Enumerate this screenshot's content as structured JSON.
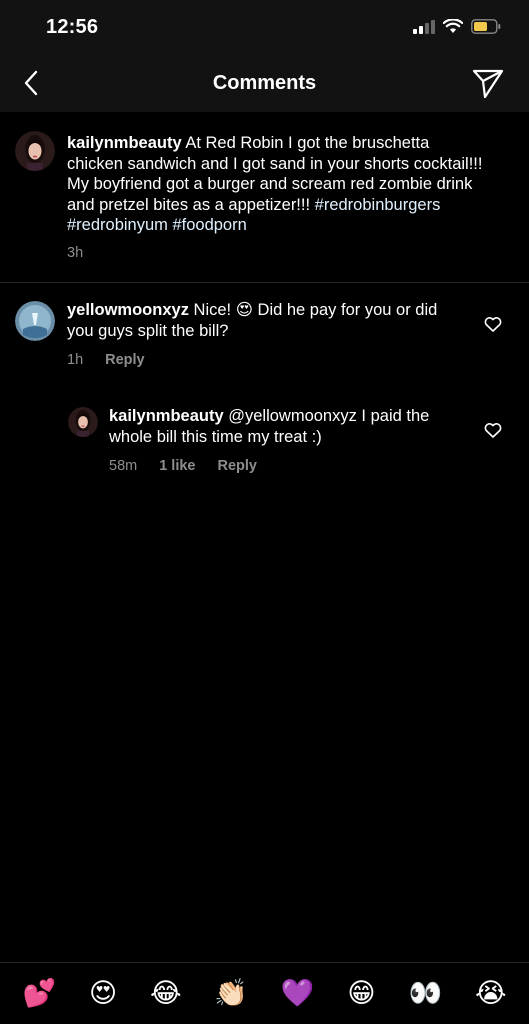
{
  "status": {
    "time": "12:56"
  },
  "header": {
    "title": "Comments"
  },
  "caption": {
    "username": "kailynmbeauty",
    "text": " At Red Robin I got the bruschetta chicken sandwich and I got sand in your shorts cocktail!!! My boyfriend got a burger and scream red zombie drink and pretzel bites as a appetizer!!!",
    "hashtags": "#redrobinburgers #redrobinyum #foodporn",
    "time": "3h"
  },
  "comments": [
    {
      "username": "yellowmoonxyz",
      "text_before": " Nice!",
      "emoji": "😍",
      "text_after": " Did he pay for you or did you guys split the bill?",
      "time": "1h",
      "reply_label": "Reply"
    }
  ],
  "replies": [
    {
      "username": "kailynmbeauty",
      "text": " @yellowmoonxyz I paid the whole bill this time my treat :)",
      "time": "58m",
      "likes": "1 like",
      "reply_label": "Reply"
    }
  ],
  "emoji_bar": [
    "💕",
    "😍",
    "😂",
    "👏🏻",
    "💜",
    "😁",
    "👀",
    "😭"
  ]
}
